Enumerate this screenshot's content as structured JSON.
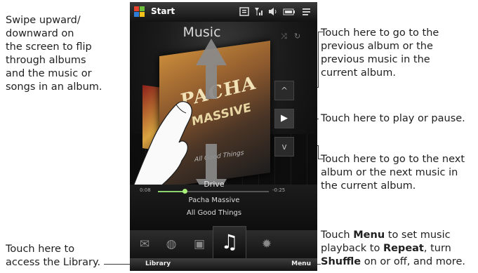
{
  "annotations": {
    "swipe": [
      "Swipe upward/",
      "downward on",
      "the screen to flip",
      "through albums",
      "and the music or",
      "songs in an album."
    ],
    "previous": [
      "Touch here to go to the",
      "previous album or the",
      "previous music in the",
      "current album."
    ],
    "play": "Touch here to play or pause.",
    "next": [
      "Touch here to go to the next",
      "album or the next music in",
      "the current album."
    ],
    "library": [
      "Touch here to",
      "access the Library."
    ],
    "menu": {
      "line1": "Touch ",
      "menu_word": "Menu",
      "line1_end": " to set music",
      "line2": "playback to ",
      "repeat_word": "Repeat",
      "line2_end": ", turn",
      "shuffle_word": "Shuffle",
      "line3_end": " on or off, and more."
    }
  },
  "phone": {
    "status": {
      "start_label": "Start"
    },
    "music_title": "Music",
    "album_art": {
      "line1": "PACHA",
      "line2": "MASSIVE",
      "line3": "All Good Things"
    },
    "now_playing": {
      "song": "Drive",
      "artist": "Pacha Massive",
      "album": "All Good Things",
      "time_elapsed": "0:08",
      "time_remaining": "-0:25",
      "progress": 0.24
    },
    "controls": {
      "prev_icon": "^",
      "play_icon": "▶",
      "next_icon": "v"
    },
    "tabs": [
      {
        "icon": "✉",
        "name": "mail"
      },
      {
        "icon": "◍",
        "name": "internet"
      },
      {
        "icon": "▣",
        "name": "photos"
      },
      {
        "icon": "♫",
        "name": "music"
      },
      {
        "icon": "✹",
        "name": "settings"
      }
    ],
    "softkeys": {
      "left": "Library",
      "right": "Menu"
    }
  },
  "colors": {
    "accent_green": "#8cd26e",
    "phone_bg": "#0d0d0d",
    "leader": "#3a3a3a"
  }
}
